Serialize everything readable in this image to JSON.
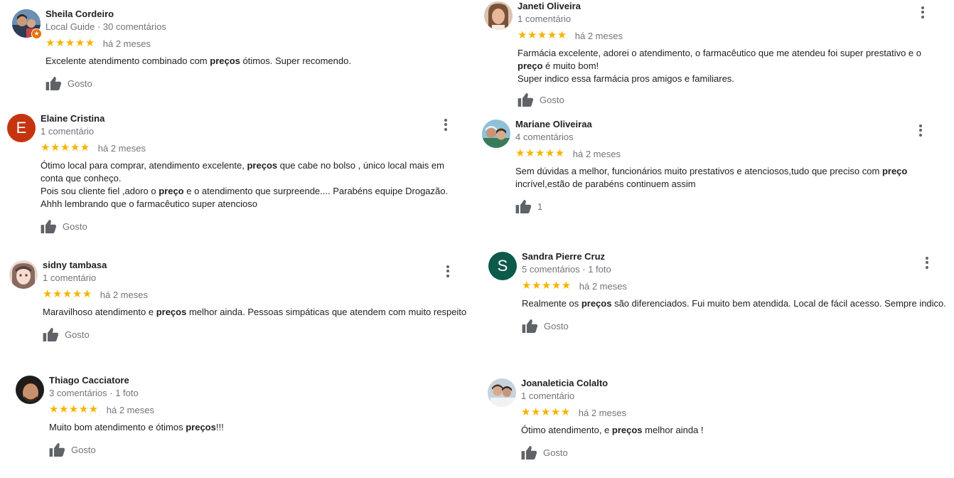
{
  "like_label": "Gosto",
  "star_glyph": "★★★★★",
  "colors": {
    "star": "#f5b400",
    "avatar_elaine": "#c5340f",
    "avatar_sandra": "#0c5a4a",
    "local_guide_badge": "#e8710a"
  },
  "reviews": [
    {
      "name": "Sheila Cordeiro",
      "meta": "Local Guide · 30 comentários",
      "when": "há 2 meses",
      "lines": [
        [
          "Excelente atendimento combinado com ",
          "preços",
          " ótimos. Super recomendo."
        ]
      ],
      "like": "Gosto",
      "avatar": "photo"
    },
    {
      "name": "Elaine Cristina",
      "meta": "1 comentário",
      "when": "há 2 meses",
      "avatar_letter": "E",
      "lines": [
        [
          "Ótimo local para comprar, atendimento excelente, ",
          "preços",
          " que cabe no bolso , único local mais em"
        ],
        [
          "conta que conheço."
        ],
        [
          "Pois sou cliente fiel ,adoro o ",
          "preço",
          " e o atendimento que surpreende.... Parabéns equipe Drogazão."
        ],
        [
          "Ahhh lembrando que o farmacêutico super atencioso"
        ]
      ],
      "like": "Gosto"
    },
    {
      "name": "sidny tambasa",
      "meta": "1 comentário",
      "when": "há 2 meses",
      "lines": [
        [
          "Maravilhoso atendimento e ",
          "preços",
          " melhor ainda. Pessoas simpáticas que atendem com muito respeito"
        ]
      ],
      "like": "Gosto",
      "avatar": "photo"
    },
    {
      "name": "Thiago Cacciatore",
      "meta": "3 comentários · 1 foto",
      "when": "há 2 meses",
      "lines": [
        [
          "Muito bom atendimento e ótimos ",
          "preços",
          "!!!"
        ]
      ],
      "like": "Gosto",
      "avatar": "photo"
    },
    {
      "name": "Janeti Oliveira",
      "meta": "1 comentário",
      "when": "há 2 meses",
      "lines": [
        [
          "Farmácia excelente, adorei o atendimento, o farmacêutico que me atendeu foi super prestativo e o"
        ],
        [
          "",
          "preço",
          " é muito bom!"
        ],
        [
          "Super indico essa farmácia pros amigos e familiares."
        ]
      ],
      "like": "Gosto",
      "avatar": "photo"
    },
    {
      "name": "Mariane Oliveiraa",
      "meta": "4 comentários",
      "when": "há 2 meses",
      "lines": [
        [
          "Sem dúvidas a melhor, funcionários muito prestativos e atenciosos,tudo que preciso com ",
          "preço"
        ],
        [
          "incrível,estão de parabéns continuem assim"
        ]
      ],
      "like": "1",
      "avatar": "photo"
    },
    {
      "name": "Sandra Pierre Cruz",
      "meta": "5 comentários · 1 foto",
      "when": "há 2 meses",
      "avatar_letter": "S",
      "lines": [
        [
          "Realmente os ",
          "preços",
          " são diferenciados. Fui muito bem atendida. Local de fácil acesso. Sempre indico."
        ]
      ],
      "like": "Gosto"
    },
    {
      "name": "Joanaleticia Colalto",
      "meta": "1 comentário",
      "when": "há 2 meses",
      "lines": [
        [
          "Ótimo atendimento, e ",
          "preços",
          " melhor ainda !"
        ]
      ],
      "like": "Gosto",
      "avatar": "photo"
    }
  ]
}
